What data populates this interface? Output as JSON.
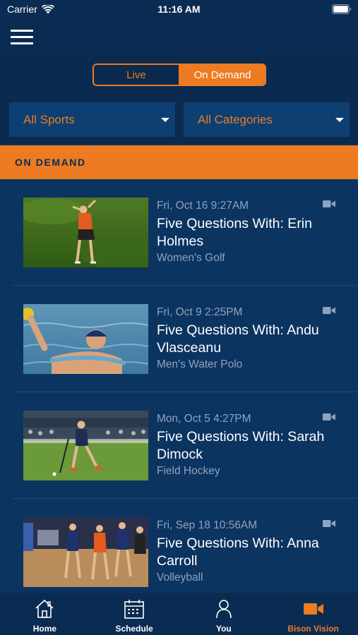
{
  "status_bar": {
    "carrier": "Carrier",
    "time": "11:16 AM"
  },
  "segmented": {
    "live_label": "Live",
    "on_demand_label": "On Demand",
    "selected": "On Demand"
  },
  "filters": {
    "sports": "All Sports",
    "categories": "All Categories"
  },
  "section": {
    "title": "ON DEMAND"
  },
  "items": [
    {
      "date": "Fri, Oct 16 9:27AM",
      "title": "Five Questions With: Erin Holmes",
      "sport": "Women's Golf",
      "thumbnail": "golf-photo"
    },
    {
      "date": "Fri, Oct 9 2:25PM",
      "title": "Five Questions With: Andu Vlasceanu",
      "sport": "Men's Water Polo",
      "thumbnail": "water-polo-photo"
    },
    {
      "date": "Mon, Oct 5 4:27PM",
      "title": "Five Questions With: Sarah Dimock",
      "sport": "Field Hockey",
      "thumbnail": "field-hockey-photo"
    },
    {
      "date": "Fri, Sep 18 10:56AM",
      "title": "Five Questions With: Anna Carroll",
      "sport": "Volleyball",
      "thumbnail": "volleyball-photo"
    }
  ],
  "tabs": [
    {
      "label": "Home",
      "icon": "home-icon"
    },
    {
      "label": "Schedule",
      "icon": "calendar-icon"
    },
    {
      "label": "You",
      "icon": "person-icon"
    },
    {
      "label": "Bison Vision",
      "icon": "video-camera-icon",
      "active": true
    }
  ],
  "colors": {
    "accent": "#ec7b22",
    "background": "#0c3461",
    "nav": "#0b2c52",
    "muted_text": "#8ea3bd"
  }
}
